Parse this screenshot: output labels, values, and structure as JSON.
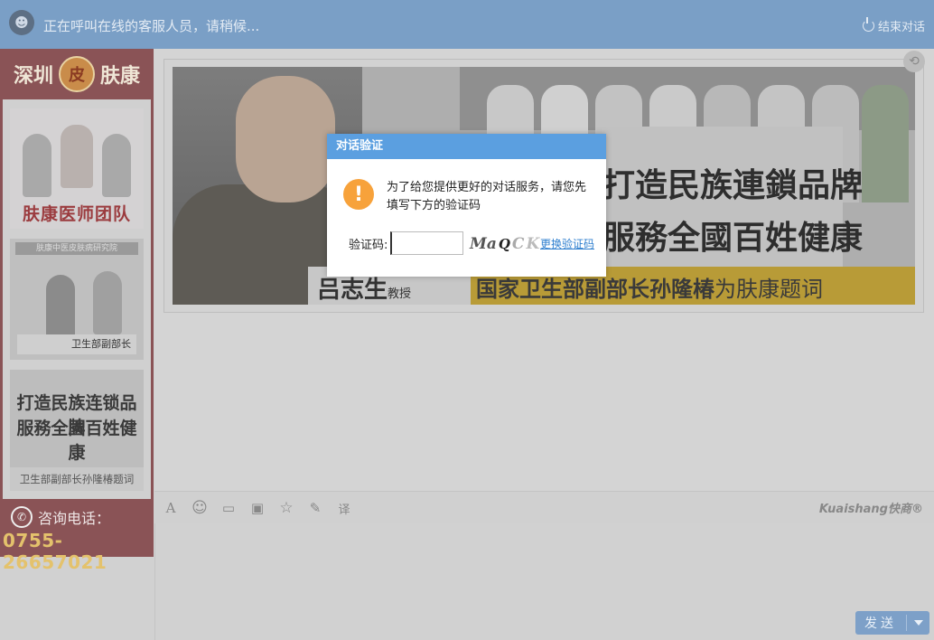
{
  "header": {
    "status_text": "正在呼叫在线的客服人员，请稍候...",
    "end_label": "结束对话"
  },
  "sidebar": {
    "brand_left": "深圳",
    "brand_logo_char": "皮",
    "brand_right": "肤康",
    "card1_title": "肤康医师团队",
    "card2_line1": "肤康中医皮肤病研究院",
    "card2_line2": "卫生部副部长",
    "card3_line1": "打造民族连锁品牌",
    "card3_line2": "服務全國百姓健康",
    "card3_caption": "卫生部副部长孙隆椿题词",
    "phone_label": "咨询电话：",
    "phone_number": "0755-26657021"
  },
  "banner": {
    "scroll_line1": "打造民族連鎖品牌",
    "scroll_line2": "服務全國百姓健康",
    "prof_name": "吕志生",
    "prof_title": "教授",
    "caption_bold": "国家卫生部副部长孙隆椿",
    "caption_rest": "为肤康题词"
  },
  "toolbar": {
    "font_icon": "A",
    "emoji_icon": "☺",
    "folder_icon": "▭",
    "image_icon": "▣",
    "star_icon": "☆",
    "edit_icon": "✎",
    "translate_icon": "译",
    "brand": "Kuaishang快商®"
  },
  "send": {
    "label": "发送"
  },
  "dialog": {
    "title": "对话验证",
    "message": "为了给您提供更好的对话服务，请您先填写下方的验证码",
    "code_label": "验证码:",
    "captcha": [
      "Ma",
      "Q",
      "C",
      "K"
    ],
    "refresh_label": "更换验证码"
  }
}
